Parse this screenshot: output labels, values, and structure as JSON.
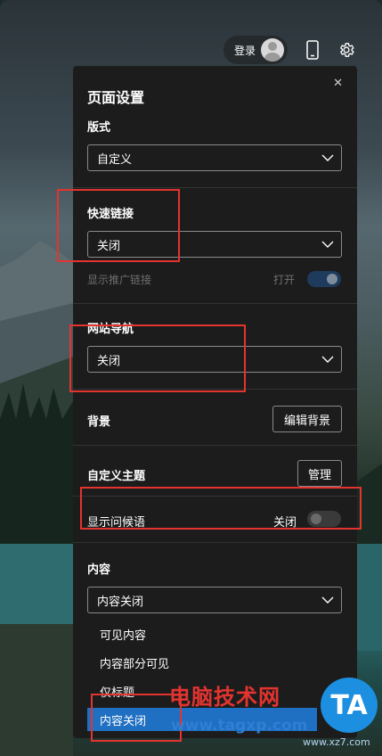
{
  "topbar": {
    "login_label": "登录",
    "icons": [
      "avatar",
      "phone-icon",
      "gear-icon"
    ]
  },
  "panel": {
    "title": "页面设置",
    "layout": {
      "label": "版式",
      "value": "自定义"
    },
    "quick_links": {
      "label": "快速链接",
      "value": "关闭"
    },
    "promo_links": {
      "label": "显示推广链接",
      "state_label": "打开",
      "on": true
    },
    "site_nav": {
      "label": "网站导航",
      "value": "关闭"
    },
    "background": {
      "label": "背景",
      "button": "编辑背景"
    },
    "custom_theme": {
      "label": "自定义主题",
      "button": "管理"
    },
    "greeting": {
      "label": "显示问候语",
      "state_label": "关闭",
      "on": false
    },
    "content": {
      "label": "内容",
      "value": "内容关闭",
      "options": [
        "可见内容",
        "内容部分可见",
        "仅标题",
        "内容关闭"
      ],
      "selected": "内容关闭"
    }
  },
  "watermark": {
    "text_cn": "电脑技术网",
    "url": "www.tagxp.com",
    "logo": "TA",
    "site2": "www.xz7.com"
  },
  "colors": {
    "accent": "#1f6fc2",
    "annotation": "#e3342f",
    "toggle_on": "#1e3a5c"
  }
}
